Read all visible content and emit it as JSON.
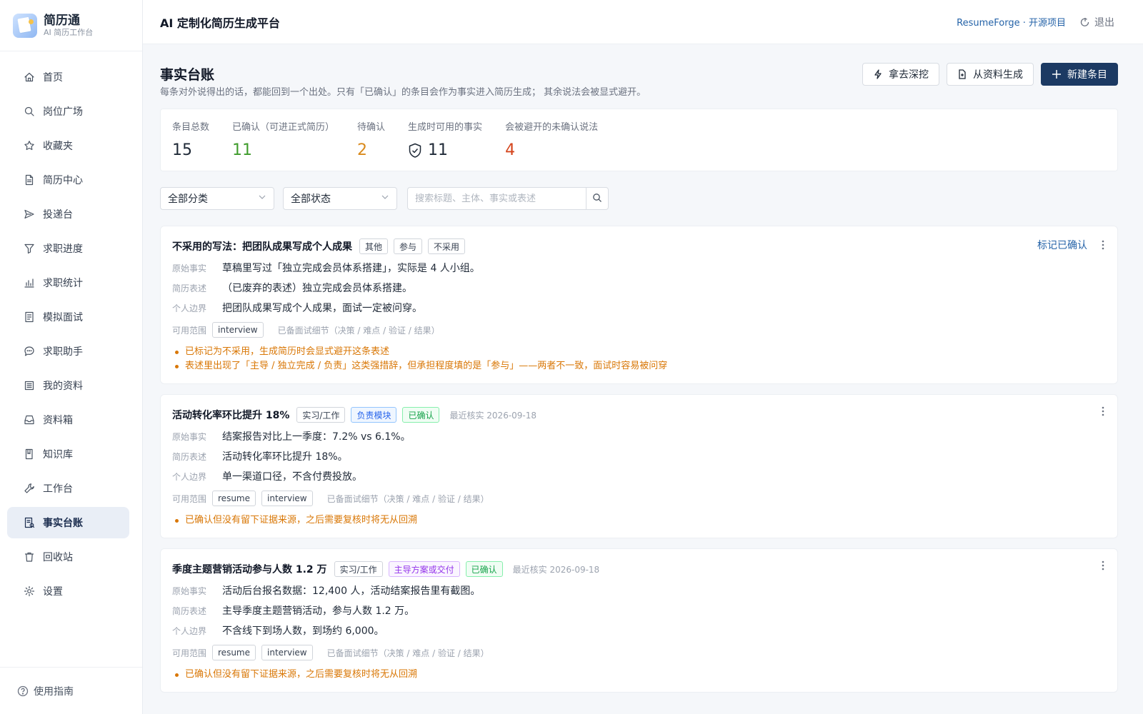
{
  "brand": {
    "name": "简历通",
    "subtitle": "AI 简历工作台"
  },
  "sidebar": {
    "items": [
      {
        "label": "首页",
        "icon": "home-icon"
      },
      {
        "label": "岗位广场",
        "icon": "search-icon"
      },
      {
        "label": "收藏夹",
        "icon": "star-icon"
      },
      {
        "label": "简历中心",
        "icon": "document-icon"
      },
      {
        "label": "投递台",
        "icon": "send-icon"
      },
      {
        "label": "求职进度",
        "icon": "filter-icon"
      },
      {
        "label": "求职统计",
        "icon": "chart-icon"
      },
      {
        "label": "模拟面试",
        "icon": "checklist-icon"
      },
      {
        "label": "求职助手",
        "icon": "chat-icon"
      },
      {
        "label": "我的资料",
        "icon": "list-icon"
      },
      {
        "label": "资料箱",
        "icon": "inbox-icon"
      },
      {
        "label": "知识库",
        "icon": "book-icon"
      },
      {
        "label": "工作台",
        "icon": "wrench-icon"
      },
      {
        "label": "事实台账",
        "icon": "ledger-icon",
        "active": true
      },
      {
        "label": "回收站",
        "icon": "trash-icon"
      },
      {
        "label": "设置",
        "icon": "gear-icon"
      }
    ],
    "footer": "使用指南"
  },
  "topbar": {
    "title": "AI 定制化简历生成平台",
    "project_link": "ResumeForge · 开源项目",
    "logout": "退出"
  },
  "page": {
    "title": "事实台账",
    "description": "每条对外说得出的话，都能回到一个出处。只有「已确认」的条目会作为事实进入简历生成；  其余说法会被显式避开。",
    "actions": {
      "dig": "拿去深挖",
      "from_material": "从资料生成",
      "new_entry": "新建条目"
    }
  },
  "stats": [
    {
      "label": "条目总数",
      "value": "15",
      "color": "#1f2937"
    },
    {
      "label": "已确认（可进正式简历）",
      "value": "11",
      "color": "#3f9c2c"
    },
    {
      "label": "待确认",
      "value": "2",
      "color": "#d98a1c"
    },
    {
      "label": "生成时可用的事实",
      "value": "11",
      "color": "#1f2937",
      "icon": "shield-check-icon"
    },
    {
      "label": "会被避开的未确认说法",
      "value": "4",
      "color": "#d4441c"
    }
  ],
  "filters": {
    "category": "全部分类",
    "status": "全部状态",
    "search_placeholder": "搜索标题、主体、事实或表述"
  },
  "labels": {
    "original_fact": "原始事实",
    "resume_expression": "简历表述",
    "personal_boundary": "个人边界",
    "scope": "可用范围",
    "interview_note": "已备面试细节（决策 / 难点 / 验证 / 结果）",
    "mark_confirmed": "标记已确认"
  },
  "cards": [
    {
      "title": "不采用的写法：把团队成果写成个人成果",
      "tags": [
        {
          "text": "其他",
          "style": "plain"
        },
        {
          "text": "参与",
          "style": "plain"
        },
        {
          "text": "不采用",
          "style": "plain"
        }
      ],
      "verified": "",
      "show_mark_confirmed": true,
      "fact": "草稿里写过「独立完成会员体系搭建」，实际是 4 人小组。",
      "expression": "（已废弃的表述）独立完成会员体系搭建。",
      "boundary": "把团队成果写成个人成果，面试一定被问穿。",
      "scopes": [
        "interview"
      ],
      "warnings": [
        "已标记为不采用，生成简历时会显式避开这条表述",
        "表述里出现了「主导 / 独立完成 / 负责」这类强措辞，但承担程度填的是「参与」——两者不一致，面试时容易被问穿"
      ]
    },
    {
      "title": "活动转化率环比提升 18%",
      "tags": [
        {
          "text": "实习/工作",
          "style": "plain"
        },
        {
          "text": "负责模块",
          "style": "blue"
        },
        {
          "text": "已确认",
          "style": "green"
        }
      ],
      "verified": "最近核实 2026-09-18",
      "show_mark_confirmed": false,
      "fact": "结案报告对比上一季度：7.2% vs 6.1%。",
      "expression": "活动转化率环比提升 18%。",
      "boundary": "单一渠道口径，不含付费投放。",
      "scopes": [
        "resume",
        "interview"
      ],
      "warnings": [
        "已确认但没有留下证据来源，之后需要复核时将无从回溯"
      ]
    },
    {
      "title": "季度主题营销活动参与人数 1.2 万",
      "tags": [
        {
          "text": "实习/工作",
          "style": "plain"
        },
        {
          "text": "主导方案或交付",
          "style": "purple"
        },
        {
          "text": "已确认",
          "style": "green"
        }
      ],
      "verified": "最近核实 2026-09-18",
      "show_mark_confirmed": false,
      "fact": "活动后台报名数据：12,400 人，活动结案报告里有截图。",
      "expression": "主导季度主题营销活动，参与人数 1.2 万。",
      "boundary": "不含线下到场人数，到场约 6,000。",
      "scopes": [
        "resume",
        "interview"
      ],
      "warnings": [
        "已确认但没有留下证据来源，之后需要复核时将无从回溯"
      ]
    }
  ]
}
